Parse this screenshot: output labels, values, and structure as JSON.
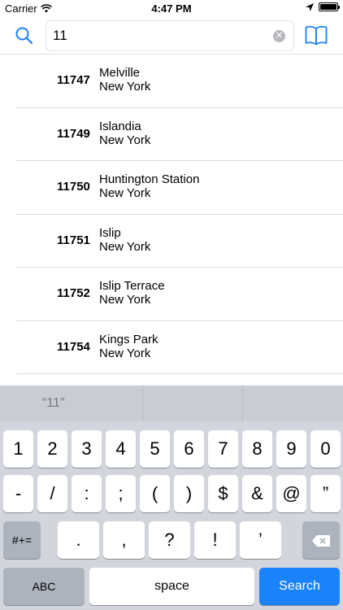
{
  "status_bar": {
    "carrier": "Carrier",
    "time": "4:47 PM"
  },
  "search": {
    "query": "11",
    "icons": {
      "left": "search-icon",
      "clear": "clear-icon",
      "right": "book-icon"
    },
    "accent_color": "#1a82fb"
  },
  "results": [
    {
      "zip": "11747",
      "city": "Melville",
      "state": "New York"
    },
    {
      "zip": "11749",
      "city": "Islandia",
      "state": "New York"
    },
    {
      "zip": "11750",
      "city": "Huntington Station",
      "state": "New York"
    },
    {
      "zip": "11751",
      "city": "Islip",
      "state": "New York"
    },
    {
      "zip": "11752",
      "city": "Islip Terrace",
      "state": "New York"
    },
    {
      "zip": "11754",
      "city": "Kings Park",
      "state": "New York"
    }
  ],
  "keyboard": {
    "suggestions": [
      "“11”",
      "",
      ""
    ],
    "row1": [
      "1",
      "2",
      "3",
      "4",
      "5",
      "6",
      "7",
      "8",
      "9",
      "0"
    ],
    "row2": [
      "-",
      "/",
      ":",
      ";",
      "(",
      ")",
      "$",
      "&",
      "@",
      "”"
    ],
    "row3": {
      "shift_label": "#+=",
      "keys": [
        ".",
        ",",
        "?",
        "!",
        "’"
      ],
      "delete_icon": "delete-icon"
    },
    "row4": {
      "abc_label": "ABC",
      "space_label": "space",
      "search_label": "Search"
    }
  }
}
